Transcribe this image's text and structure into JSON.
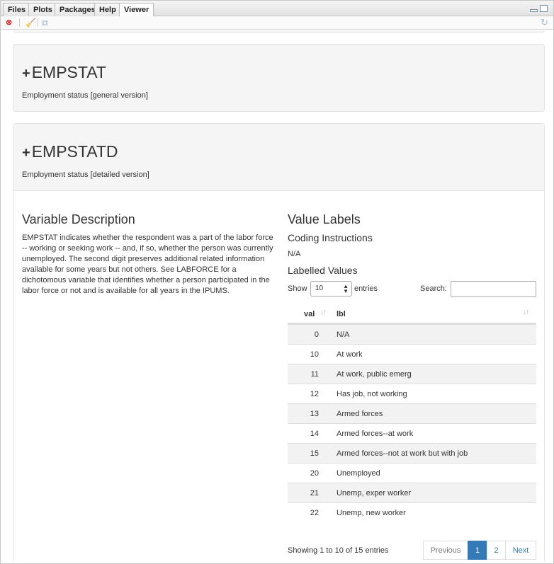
{
  "tabs": [
    "Files",
    "Plots",
    "Packages",
    "Help",
    "Viewer"
  ],
  "active_tab": "Viewer",
  "sections": {
    "empstat": {
      "title": "EMPSTAT",
      "subtitle": "Employment status [general version]"
    },
    "empstatd": {
      "title": "EMPSTATD",
      "subtitle": "Employment status [detailed version]"
    }
  },
  "variable_description": {
    "heading": "Variable Description",
    "text": "EMPSTAT indicates whether the respondent was a part of the labor force -- working or seeking work -- and, if so, whether the person was currently unemployed. The second digit preserves additional related information available for some years but not others. See LABFORCE for a dichotomous variable that identifies whether a person participated in the labor force or not and is available for all years in the IPUMS."
  },
  "value_labels": {
    "heading": "Value Labels",
    "coding_heading": "Coding Instructions",
    "coding_text": "N/A",
    "labelled_heading": "Labelled Values",
    "show_label": "Show",
    "entries_value": "10",
    "entries_label": "entries",
    "search_label": "Search:",
    "search_value": "",
    "columns": [
      "val",
      "lbl"
    ],
    "rows": [
      {
        "val": "0",
        "lbl": "N/A"
      },
      {
        "val": "10",
        "lbl": "At work"
      },
      {
        "val": "11",
        "lbl": "At work, public emerg"
      },
      {
        "val": "12",
        "lbl": "Has job, not working"
      },
      {
        "val": "13",
        "lbl": "Armed forces"
      },
      {
        "val": "14",
        "lbl": "Armed forces--at work"
      },
      {
        "val": "15",
        "lbl": "Armed forces--not at work but with job"
      },
      {
        "val": "20",
        "lbl": "Unemployed"
      },
      {
        "val": "21",
        "lbl": "Unemp, exper worker"
      },
      {
        "val": "22",
        "lbl": "Unemp, new worker"
      }
    ],
    "info": "Showing 1 to 10 of 15 entries",
    "pagination": {
      "previous": "Previous",
      "pages": [
        "1",
        "2"
      ],
      "current_page": "1",
      "next": "Next"
    }
  },
  "colors": {
    "accent": "#337ab7",
    "well": "#f5f5f5",
    "stripe": "#f2f2f2"
  }
}
